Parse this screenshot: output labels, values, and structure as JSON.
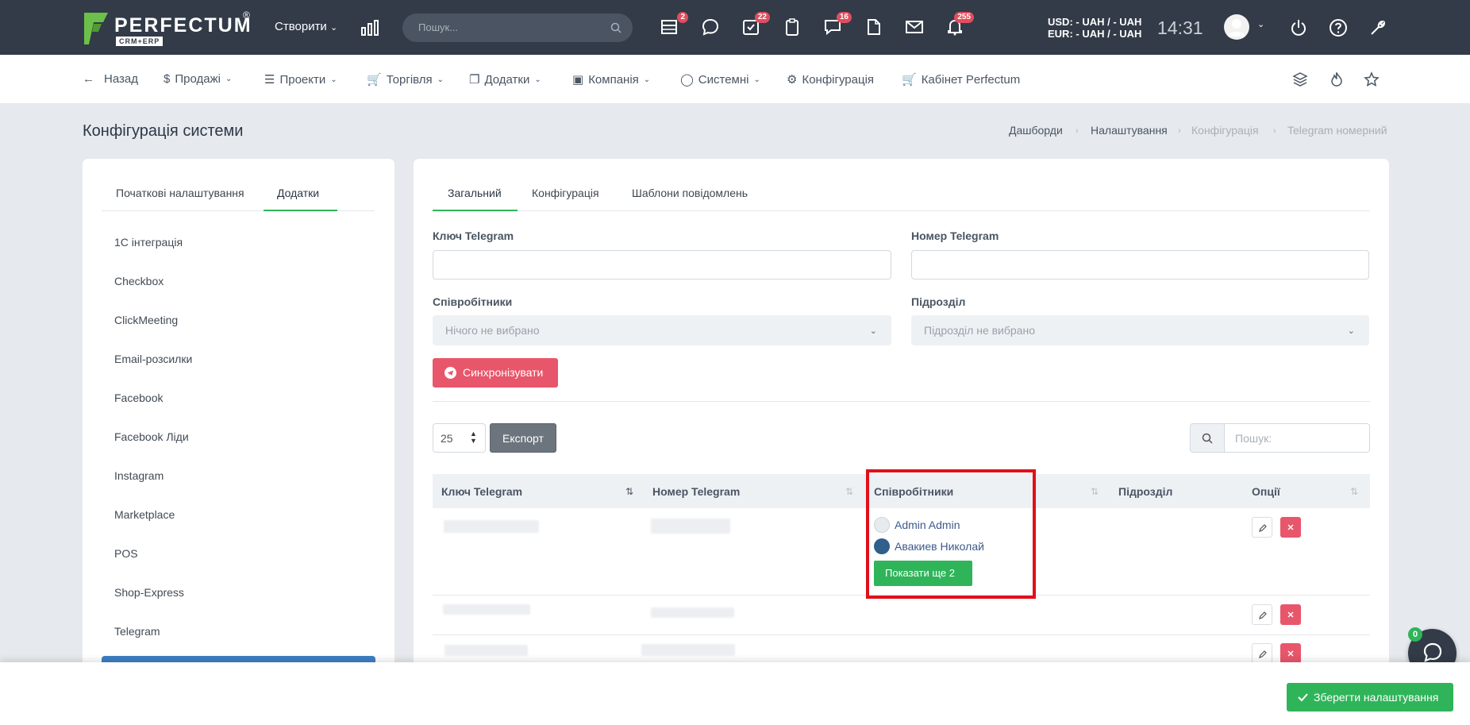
{
  "topbar": {
    "logo": "PERFECTUM",
    "logo_sub": "CRM+ERP",
    "logo_reg": "®",
    "create_label": "Створити",
    "search_placeholder": "Пошук...",
    "badges": {
      "tasks": "2",
      "todo": "22",
      "chat": "16",
      "alerts": "255"
    },
    "usd": "USD: - UAH / - UAH",
    "eur": "EUR: - UAH / - UAH",
    "time": "14:31"
  },
  "nav": {
    "back": "Назад",
    "sales": "Продажі",
    "projects": "Проекти",
    "trade": "Торгівля",
    "addons": "Додатки",
    "company": "Компанія",
    "system": "Системні",
    "config": "Конфігурація",
    "cabinet": "Кабінет Perfectum"
  },
  "page": {
    "title": "Конфігурація системи",
    "breadcrumb": [
      "Дашборди",
      "Налаштування",
      "Конфігурація",
      "Telegram номерний"
    ]
  },
  "sidebar": {
    "tabs": [
      "Початкові налаштування",
      "Додатки"
    ],
    "items": [
      "1С інтеграція",
      "Checkbox",
      "ClickMeeting",
      "Email-розсилки",
      "Facebook",
      "Facebook Ліди",
      "Instagram",
      "Marketplace",
      "POS",
      "Shop-Express",
      "Telegram"
    ]
  },
  "main": {
    "tabs": [
      "Загальний",
      "Конфігурація",
      "Шаблони повідомлень"
    ],
    "key_label": "Ключ Telegram",
    "number_label": "Номер Telegram",
    "employees_label": "Співробітники",
    "employees_placeholder": "Нічого не вибрано",
    "department_label": "Підрозділ",
    "department_placeholder": "Підрозділ не вибрано",
    "sync_button": "Синхронізувати",
    "page_size": "25",
    "export_button": "Експорт",
    "table_search_placeholder": "Пошук:"
  },
  "table": {
    "headers": [
      "Ключ Telegram",
      "Номер Telegram",
      "Співробітники",
      "Підрозділ",
      "Опції"
    ],
    "employees": [
      "Admin Admin",
      "Авакиев Николай"
    ],
    "show_more": "Показати ще 2"
  },
  "footer": {
    "save_button": "Зберегти налаштування",
    "chat_badge": "0"
  },
  "colors": {
    "topbar": "#323b47",
    "accent_green": "#2fb45a",
    "danger": "#e8566b",
    "highlight_box": "#e0101a",
    "sidebar_active": "#3d7fc4"
  }
}
